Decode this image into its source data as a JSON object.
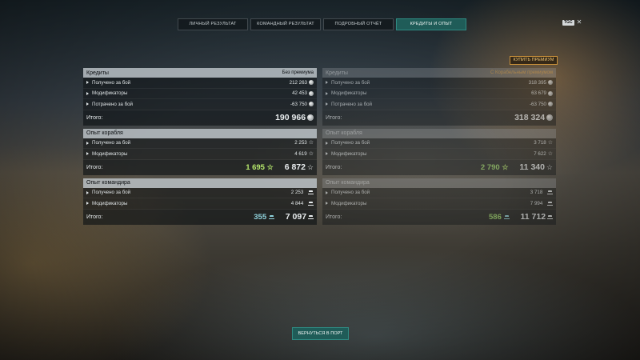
{
  "tabs": [
    {
      "label": "ЛИЧНЫЙ РЕЗУЛЬТАТ",
      "active": false
    },
    {
      "label": "КОМАНДНЫЙ РЕЗУЛЬТАТ",
      "active": false
    },
    {
      "label": "ПОДРОБНЫЙ ОТЧЁТ",
      "active": false
    },
    {
      "label": "КРЕДИТЫ И ОПЫТ",
      "active": true
    }
  ],
  "header": {
    "badge": "TGC",
    "close": "✕"
  },
  "buy_premium": "КУПИТЬ ПРЕМИУМ",
  "left": {
    "credits": {
      "title": "Кредиты",
      "subtitle": "Без премиума",
      "rows": [
        {
          "label": "Получено за бой",
          "value": "212 263"
        },
        {
          "label": "Модификаторы",
          "value": "42 453"
        },
        {
          "label": "Потрачено за бой",
          "value": "-63 750"
        }
      ],
      "total_label": "Итого:",
      "total": "190 966"
    },
    "ship_xp": {
      "title": "Опыт корабля",
      "rows": [
        {
          "label": "Получено за бой",
          "value": "2 253"
        },
        {
          "label": "Модификаторы",
          "value": "4 619"
        }
      ],
      "total_label": "Итого:",
      "total_free": "1 695",
      "total": "6 872"
    },
    "cmdr_xp": {
      "title": "Опыт командира",
      "rows": [
        {
          "label": "Получено за бой",
          "value": "2 253"
        },
        {
          "label": "Модификаторы",
          "value": "4 844"
        }
      ],
      "total_label": "Итого:",
      "total_free": "355",
      "total": "7 097"
    }
  },
  "right": {
    "credits": {
      "title": "Кредиты",
      "subtitle": "С Корабельным премиумом",
      "rows": [
        {
          "label": "Получено за бой",
          "value": "318 395"
        },
        {
          "label": "Модификаторы",
          "value": "63 679"
        },
        {
          "label": "Потрачено за бой",
          "value": "-63 750"
        }
      ],
      "total_label": "Итого:",
      "total": "318 324"
    },
    "ship_xp": {
      "title": "Опыт корабля",
      "rows": [
        {
          "label": "Получено за бой",
          "value": "3 718"
        },
        {
          "label": "Модификаторы",
          "value": "7 622"
        }
      ],
      "total_label": "Итого:",
      "total_free": "2 790",
      "total": "11 340"
    },
    "cmdr_xp": {
      "title": "Опыт командира",
      "rows": [
        {
          "label": "Получено за бой",
          "value": "3 718"
        },
        {
          "label": "Модификаторы",
          "value": "7 994"
        }
      ],
      "total_label": "Итого:",
      "total_free": "586",
      "total": "11 712"
    }
  },
  "back_button": "ВЕРНУТЬСЯ В ПОРТ",
  "icons": {
    "credits": "coin-icon",
    "ship_xp": "star-icon",
    "cmdr_xp": "commander-cap-icon"
  },
  "colors": {
    "accent": "#1f5c58",
    "free_xp": "#b6e86c",
    "commander_xp": "#8fd2dc",
    "premium": "#d8a455"
  }
}
